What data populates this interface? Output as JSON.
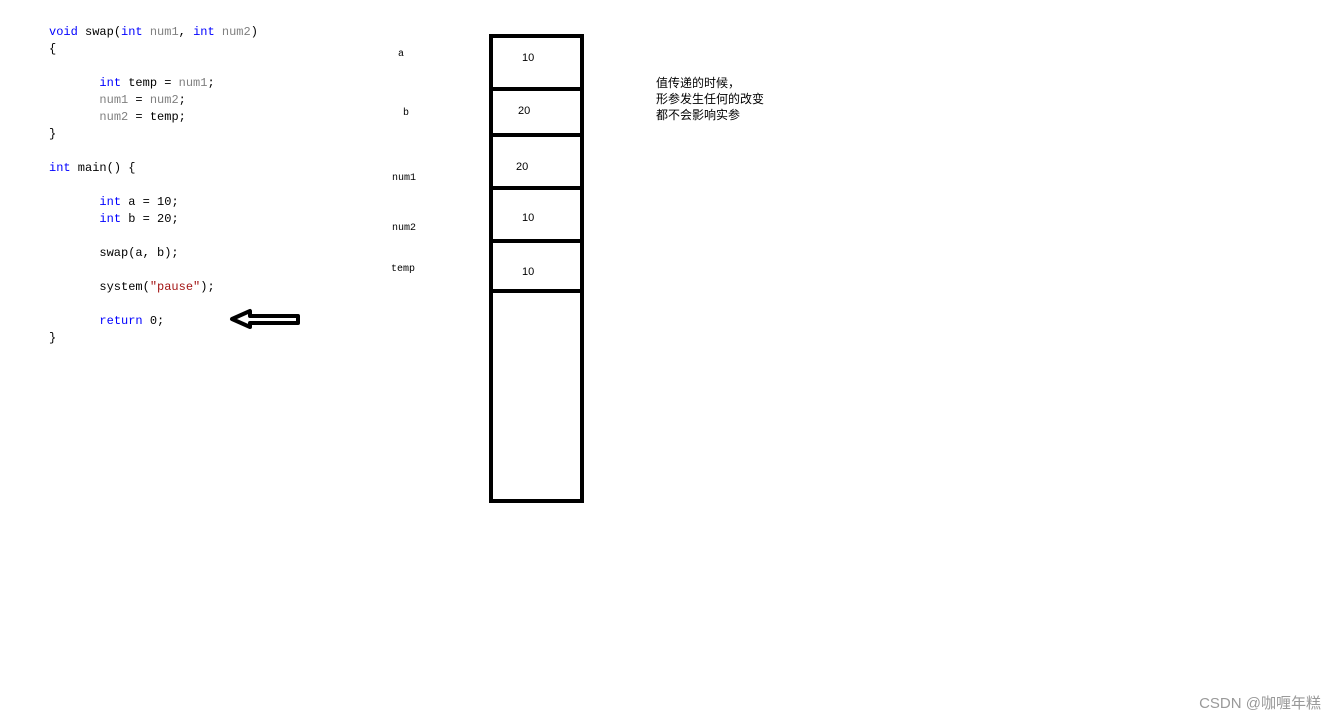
{
  "code": {
    "lines": [
      {
        "tokens": [
          {
            "t": "void",
            "c": "kw"
          },
          {
            "t": " swap(",
            "c": ""
          },
          {
            "t": "int",
            "c": "kw"
          },
          {
            "t": " ",
            "c": ""
          },
          {
            "t": "num1",
            "c": "param"
          },
          {
            "t": ", ",
            "c": ""
          },
          {
            "t": "int",
            "c": "kw"
          },
          {
            "t": " ",
            "c": ""
          },
          {
            "t": "num2",
            "c": "param"
          },
          {
            "t": ")",
            "c": ""
          }
        ]
      },
      {
        "tokens": [
          {
            "t": "{",
            "c": ""
          }
        ]
      },
      {
        "tokens": []
      },
      {
        "tokens": [
          {
            "t": "       ",
            "c": ""
          },
          {
            "t": "int",
            "c": "kw"
          },
          {
            "t": " temp = ",
            "c": ""
          },
          {
            "t": "num1",
            "c": "param"
          },
          {
            "t": ";",
            "c": ""
          }
        ]
      },
      {
        "tokens": [
          {
            "t": "       ",
            "c": ""
          },
          {
            "t": "num1",
            "c": "param"
          },
          {
            "t": " = ",
            "c": ""
          },
          {
            "t": "num2",
            "c": "param"
          },
          {
            "t": ";",
            "c": ""
          }
        ]
      },
      {
        "tokens": [
          {
            "t": "       ",
            "c": ""
          },
          {
            "t": "num2",
            "c": "param"
          },
          {
            "t": " = temp;",
            "c": ""
          }
        ]
      },
      {
        "tokens": [
          {
            "t": "}",
            "c": ""
          }
        ]
      },
      {
        "tokens": []
      },
      {
        "tokens": [
          {
            "t": "int",
            "c": "kw"
          },
          {
            "t": " main() {",
            "c": ""
          }
        ]
      },
      {
        "tokens": []
      },
      {
        "tokens": [
          {
            "t": "       ",
            "c": ""
          },
          {
            "t": "int",
            "c": "kw"
          },
          {
            "t": " a = 10;",
            "c": ""
          }
        ]
      },
      {
        "tokens": [
          {
            "t": "       ",
            "c": ""
          },
          {
            "t": "int",
            "c": "kw"
          },
          {
            "t": " b = 20;",
            "c": ""
          }
        ]
      },
      {
        "tokens": []
      },
      {
        "tokens": [
          {
            "t": "       swap(a, b);",
            "c": ""
          }
        ]
      },
      {
        "tokens": []
      },
      {
        "tokens": [
          {
            "t": "       system(",
            "c": ""
          },
          {
            "t": "\"pause\"",
            "c": "str"
          },
          {
            "t": ");",
            "c": ""
          }
        ]
      },
      {
        "tokens": []
      },
      {
        "tokens": [
          {
            "t": "       ",
            "c": ""
          },
          {
            "t": "return",
            "c": "kw"
          },
          {
            "t": " 0;",
            "c": ""
          }
        ]
      },
      {
        "tokens": [
          {
            "t": "}",
            "c": ""
          }
        ]
      }
    ]
  },
  "pointer": {
    "icon": "left-arrow-icon"
  },
  "stack": {
    "labels": {
      "a": "a",
      "b": "b",
      "num1": "num1",
      "num2": "num2",
      "temp": "temp"
    },
    "values": {
      "a": "10",
      "b": "20",
      "num1": "20",
      "num2": "10",
      "temp": "10"
    }
  },
  "note": {
    "lines": [
      "值传递的时候，",
      "形参发生任何的改变",
      "都不会影响实参"
    ]
  },
  "watermark": "CSDN @咖喱年糕"
}
